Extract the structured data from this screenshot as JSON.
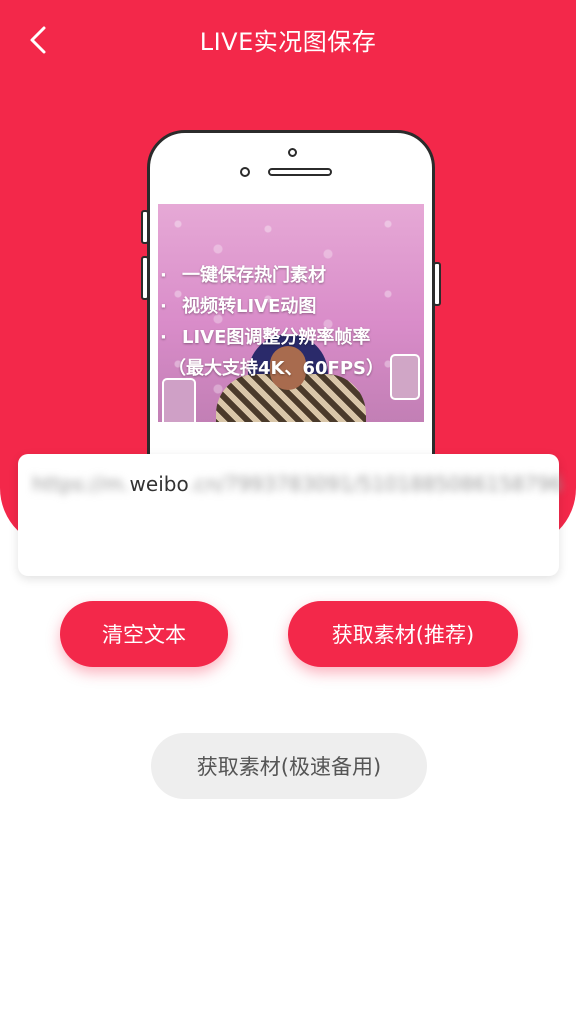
{
  "header": {
    "title": "LIVE实况图保存",
    "back_icon": "back-chevron-icon"
  },
  "colors": {
    "accent": "#f3284a",
    "card_background": "#ffffff",
    "secondary_button": "#eeeeee"
  },
  "promo": {
    "features": [
      "一键保存热门素材",
      "视频转LIVE动图",
      "LIVE图调整分辨率帧率"
    ],
    "feature_extra": "（最大支持4K、60FPS）"
  },
  "url_field": {
    "prefix_blurred": "https://m.",
    "visible_text": "weibo",
    "suffix_blurred": ".cn/7993783091/5101885086158796"
  },
  "buttons": {
    "clear_label": "清空文本",
    "get_label": "获取素材(推荐)",
    "get_fast_label": "获取素材(极速备用)"
  }
}
